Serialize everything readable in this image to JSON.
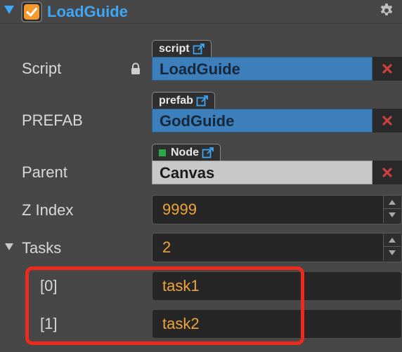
{
  "component": {
    "title": "LoadGuide",
    "enabled": true
  },
  "properties": {
    "script": {
      "label": "Script",
      "tag": "script",
      "value": "LoadGuide"
    },
    "prefab": {
      "label": "PREFAB",
      "tag": "prefab",
      "value": "GodGuide"
    },
    "parent": {
      "label": "Parent",
      "tag": "Node",
      "value": "Canvas"
    },
    "z_index": {
      "label": "Z Index",
      "value": "9999"
    },
    "tasks": {
      "label": "Tasks",
      "count": "2",
      "items": [
        {
          "index_label": "[0]",
          "value": "task1"
        },
        {
          "index_label": "[1]",
          "value": "task2"
        }
      ]
    }
  },
  "colors": {
    "accent": "#3ea6f5",
    "number_text": "#f0a33a",
    "asset_field": "#3c7fba",
    "node_field": "#c8c8c8",
    "remove_x": "#c94040",
    "highlight": "#ee2a1e"
  },
  "icons": [
    "collapse-triangle-icon",
    "checkbox-check-icon",
    "gear-icon",
    "lock-icon",
    "external-link-icon",
    "remove-x-icon",
    "spin-up-icon",
    "spin-down-icon"
  ]
}
